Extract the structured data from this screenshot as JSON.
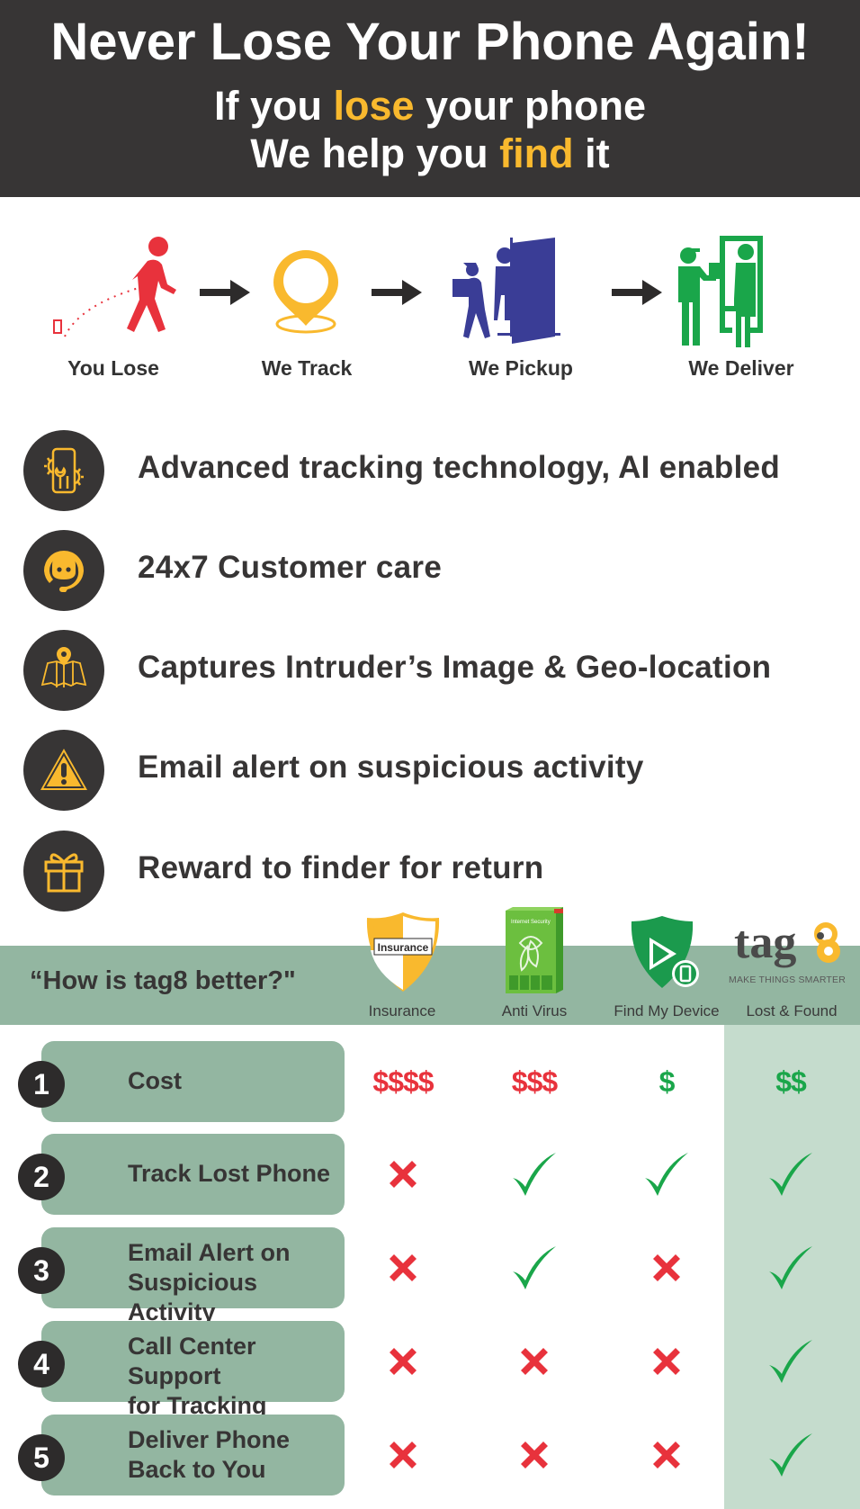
{
  "header": {
    "title": "Never Lose Your Phone Again!",
    "line1": {
      "pre": "If you ",
      "highlight": "lose",
      "post": " your phone"
    },
    "line2": {
      "pre": "We help you ",
      "highlight": "find",
      "post": " it"
    },
    "colors": {
      "background": "#373535",
      "highlight": "#f9b92e"
    }
  },
  "steps": [
    {
      "label": "You Lose",
      "icon": "walking-person-dropping-phone-icon",
      "color": "#e8323c"
    },
    {
      "label": "We Track",
      "icon": "location-pin-icon",
      "color": "#f9b92e"
    },
    {
      "label": "We Pickup",
      "icon": "courier-at-door-icon",
      "color": "#3a3d96"
    },
    {
      "label": "We Deliver",
      "icon": "handover-delivery-icon",
      "color": "#1aa64a"
    }
  ],
  "features": [
    {
      "text": "Advanced tracking technology, AI enabled",
      "icon": "phone-wrench-gears-icon"
    },
    {
      "text": "24x7 Customer care",
      "icon": "customer-support-headset-icon"
    },
    {
      "text": "Captures Intruder’s Image & Geo-location",
      "icon": "map-pin-icon"
    },
    {
      "text": "Email alert on suspicious activity",
      "icon": "warning-triangle-icon"
    },
    {
      "text": "Reward to finder for return",
      "icon": "gift-icon"
    }
  ],
  "comparison": {
    "question": "“How is tag8 better?\"",
    "columns": [
      {
        "label": "Insurance",
        "logo_text": "Insurance",
        "icon": "insurance-shield-icon"
      },
      {
        "label": "Anti Virus",
        "icon": "antivirus-box-icon"
      },
      {
        "label": "Find My Device",
        "icon": "find-my-device-shield-icon"
      },
      {
        "label": "Lost & Found",
        "logo_text": "tag8",
        "tagline": "MAKE THINGS SMARTER",
        "icon": "tag8-logo-icon"
      }
    ],
    "rows": [
      {
        "num": "1",
        "label": [
          "Cost"
        ],
        "values": [
          "$$$$",
          "$$$",
          "$",
          "$$"
        ],
        "value_colors": [
          "#e8323c",
          "#e8323c",
          "#1aa64a",
          "#1aa64a"
        ]
      },
      {
        "num": "2",
        "label": [
          "Track Lost Phone"
        ],
        "values": [
          "no",
          "yes",
          "yes",
          "yes"
        ]
      },
      {
        "num": "3",
        "label": [
          "Email Alert on",
          "Suspicious Activity"
        ],
        "values": [
          "no",
          "yes",
          "no",
          "yes"
        ]
      },
      {
        "num": "4",
        "label": [
          "Call Center Support",
          "for Tracking Phone"
        ],
        "values": [
          "no",
          "no",
          "no",
          "yes"
        ]
      },
      {
        "num": "5",
        "label": [
          "Deliver Phone",
          "Back to You"
        ],
        "values": [
          "no",
          "no",
          "no",
          "yes"
        ]
      }
    ],
    "colors": {
      "band": "#93b6a1",
      "tag8_column": "#c5dccd",
      "yes": "#1aa64a",
      "no": "#e8323c"
    }
  }
}
